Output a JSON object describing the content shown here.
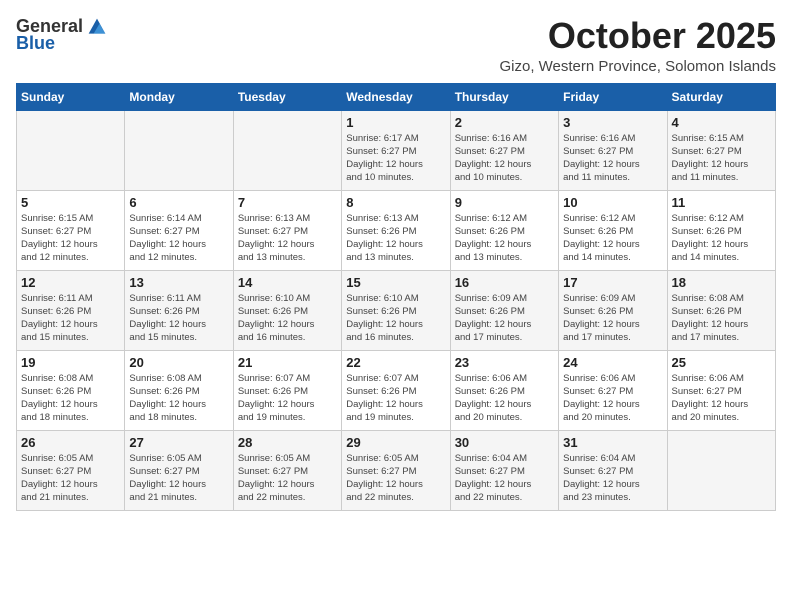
{
  "logo": {
    "general": "General",
    "blue": "Blue"
  },
  "title": "October 2025",
  "location": "Gizo, Western Province, Solomon Islands",
  "weekdays": [
    "Sunday",
    "Monday",
    "Tuesday",
    "Wednesday",
    "Thursday",
    "Friday",
    "Saturday"
  ],
  "weeks": [
    [
      {
        "day": "",
        "info": ""
      },
      {
        "day": "",
        "info": ""
      },
      {
        "day": "",
        "info": ""
      },
      {
        "day": "1",
        "info": "Sunrise: 6:17 AM\nSunset: 6:27 PM\nDaylight: 12 hours\nand 10 minutes."
      },
      {
        "day": "2",
        "info": "Sunrise: 6:16 AM\nSunset: 6:27 PM\nDaylight: 12 hours\nand 10 minutes."
      },
      {
        "day": "3",
        "info": "Sunrise: 6:16 AM\nSunset: 6:27 PM\nDaylight: 12 hours\nand 11 minutes."
      },
      {
        "day": "4",
        "info": "Sunrise: 6:15 AM\nSunset: 6:27 PM\nDaylight: 12 hours\nand 11 minutes."
      }
    ],
    [
      {
        "day": "5",
        "info": "Sunrise: 6:15 AM\nSunset: 6:27 PM\nDaylight: 12 hours\nand 12 minutes."
      },
      {
        "day": "6",
        "info": "Sunrise: 6:14 AM\nSunset: 6:27 PM\nDaylight: 12 hours\nand 12 minutes."
      },
      {
        "day": "7",
        "info": "Sunrise: 6:13 AM\nSunset: 6:27 PM\nDaylight: 12 hours\nand 13 minutes."
      },
      {
        "day": "8",
        "info": "Sunrise: 6:13 AM\nSunset: 6:26 PM\nDaylight: 12 hours\nand 13 minutes."
      },
      {
        "day": "9",
        "info": "Sunrise: 6:12 AM\nSunset: 6:26 PM\nDaylight: 12 hours\nand 13 minutes."
      },
      {
        "day": "10",
        "info": "Sunrise: 6:12 AM\nSunset: 6:26 PM\nDaylight: 12 hours\nand 14 minutes."
      },
      {
        "day": "11",
        "info": "Sunrise: 6:12 AM\nSunset: 6:26 PM\nDaylight: 12 hours\nand 14 minutes."
      }
    ],
    [
      {
        "day": "12",
        "info": "Sunrise: 6:11 AM\nSunset: 6:26 PM\nDaylight: 12 hours\nand 15 minutes."
      },
      {
        "day": "13",
        "info": "Sunrise: 6:11 AM\nSunset: 6:26 PM\nDaylight: 12 hours\nand 15 minutes."
      },
      {
        "day": "14",
        "info": "Sunrise: 6:10 AM\nSunset: 6:26 PM\nDaylight: 12 hours\nand 16 minutes."
      },
      {
        "day": "15",
        "info": "Sunrise: 6:10 AM\nSunset: 6:26 PM\nDaylight: 12 hours\nand 16 minutes."
      },
      {
        "day": "16",
        "info": "Sunrise: 6:09 AM\nSunset: 6:26 PM\nDaylight: 12 hours\nand 17 minutes."
      },
      {
        "day": "17",
        "info": "Sunrise: 6:09 AM\nSunset: 6:26 PM\nDaylight: 12 hours\nand 17 minutes."
      },
      {
        "day": "18",
        "info": "Sunrise: 6:08 AM\nSunset: 6:26 PM\nDaylight: 12 hours\nand 17 minutes."
      }
    ],
    [
      {
        "day": "19",
        "info": "Sunrise: 6:08 AM\nSunset: 6:26 PM\nDaylight: 12 hours\nand 18 minutes."
      },
      {
        "day": "20",
        "info": "Sunrise: 6:08 AM\nSunset: 6:26 PM\nDaylight: 12 hours\nand 18 minutes."
      },
      {
        "day": "21",
        "info": "Sunrise: 6:07 AM\nSunset: 6:26 PM\nDaylight: 12 hours\nand 19 minutes."
      },
      {
        "day": "22",
        "info": "Sunrise: 6:07 AM\nSunset: 6:26 PM\nDaylight: 12 hours\nand 19 minutes."
      },
      {
        "day": "23",
        "info": "Sunrise: 6:06 AM\nSunset: 6:26 PM\nDaylight: 12 hours\nand 20 minutes."
      },
      {
        "day": "24",
        "info": "Sunrise: 6:06 AM\nSunset: 6:27 PM\nDaylight: 12 hours\nand 20 minutes."
      },
      {
        "day": "25",
        "info": "Sunrise: 6:06 AM\nSunset: 6:27 PM\nDaylight: 12 hours\nand 20 minutes."
      }
    ],
    [
      {
        "day": "26",
        "info": "Sunrise: 6:05 AM\nSunset: 6:27 PM\nDaylight: 12 hours\nand 21 minutes."
      },
      {
        "day": "27",
        "info": "Sunrise: 6:05 AM\nSunset: 6:27 PM\nDaylight: 12 hours\nand 21 minutes."
      },
      {
        "day": "28",
        "info": "Sunrise: 6:05 AM\nSunset: 6:27 PM\nDaylight: 12 hours\nand 22 minutes."
      },
      {
        "day": "29",
        "info": "Sunrise: 6:05 AM\nSunset: 6:27 PM\nDaylight: 12 hours\nand 22 minutes."
      },
      {
        "day": "30",
        "info": "Sunrise: 6:04 AM\nSunset: 6:27 PM\nDaylight: 12 hours\nand 22 minutes."
      },
      {
        "day": "31",
        "info": "Sunrise: 6:04 AM\nSunset: 6:27 PM\nDaylight: 12 hours\nand 23 minutes."
      },
      {
        "day": "",
        "info": ""
      }
    ]
  ]
}
